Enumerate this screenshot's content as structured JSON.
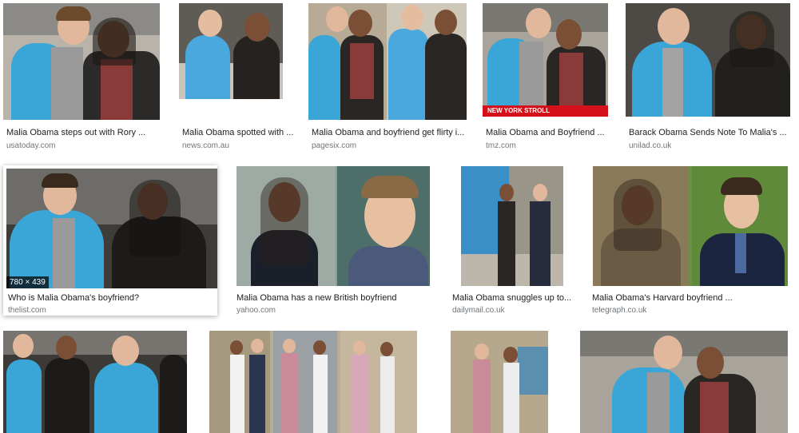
{
  "results": [
    {
      "caption": "Malia Obama steps out with Rory ...",
      "source": "usatoday.com"
    },
    {
      "caption": "Malia Obama spotted with ...",
      "source": "news.com.au"
    },
    {
      "caption": "Malia Obama and boyfriend get flirty i...",
      "source": "pagesix.com"
    },
    {
      "caption": "Malia Obama and Boyfriend ...",
      "source": "tmz.com"
    },
    {
      "caption": "Barack Obama Sends Note To Malia's ...",
      "source": "unilad.co.uk"
    },
    {
      "caption": "Who is Malia Obama's boyfriend?",
      "source": "thelist.com",
      "dimensions": "780 × 439"
    },
    {
      "caption": "Malia Obama has a new British boyfriend",
      "source": "yahoo.com"
    },
    {
      "caption": "Malia Obama snuggles up to...",
      "source": "dailymail.co.uk"
    },
    {
      "caption": "Malia Obama's Harvard boyfriend ...",
      "source": "telegraph.co.uk"
    }
  ],
  "tmz_banner": "NEW YORK STROLL",
  "colors": {
    "caption": "#202124",
    "source": "#70757a",
    "puffer_blue": "#3aa6d8",
    "tmz_red": "#d4111a"
  }
}
